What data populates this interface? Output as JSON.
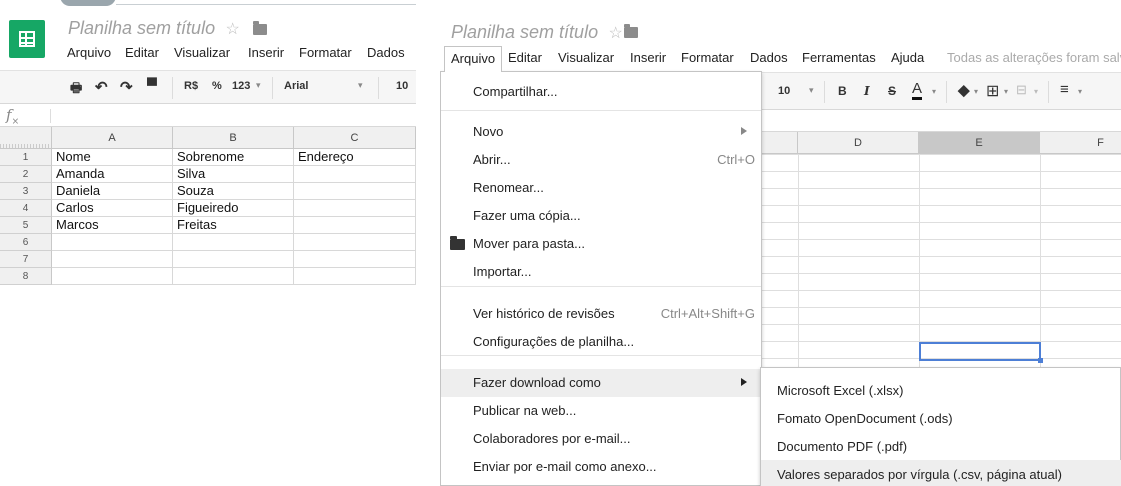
{
  "left": {
    "title": "Planilha sem título",
    "menu": [
      "Arquivo",
      "Editar",
      "Visualizar",
      "Inserir",
      "Formatar",
      "Dados"
    ],
    "toolbar": {
      "currency": "R$",
      "percent": "%",
      "number_format": "123",
      "font": "Arial",
      "font_size": "10"
    },
    "fx_label": "fx",
    "columns": [
      "A",
      "B",
      "C"
    ],
    "rows": [
      "1",
      "2",
      "3",
      "4",
      "5",
      "6",
      "7",
      "8"
    ],
    "cells": [
      [
        "Nome",
        "Sobrenome",
        "Endereço"
      ],
      [
        "Amanda",
        "Silva",
        ""
      ],
      [
        "Daniela",
        "Souza",
        ""
      ],
      [
        "Carlos",
        "Figueiredo",
        ""
      ],
      [
        "Marcos",
        "Freitas",
        ""
      ],
      [
        "",
        "",
        ""
      ],
      [
        "",
        "",
        ""
      ],
      [
        "",
        "",
        ""
      ]
    ]
  },
  "right": {
    "title": "Planilha sem título",
    "menu": [
      "Arquivo",
      "Editar",
      "Visualizar",
      "Inserir",
      "Formatar",
      "Dados",
      "Ferramentas",
      "Ajuda"
    ],
    "saved_status": "Todas as alterações foram salvas no Drive",
    "toolbar": {
      "font_size": "10",
      "bold": "B",
      "italic": "I",
      "strike": "S",
      "text_color": "A"
    },
    "columns": [
      "D",
      "E",
      "F"
    ],
    "file_menu": {
      "items": [
        {
          "label": "Compartilhar...",
          "shortcut": ""
        },
        {
          "label": "Novo",
          "shortcut": "",
          "submenu": true
        },
        {
          "label": "Abrir...",
          "shortcut": "Ctrl+O"
        },
        {
          "label": "Renomear...",
          "shortcut": ""
        },
        {
          "label": "Fazer uma cópia...",
          "shortcut": ""
        },
        {
          "label": "Mover para pasta...",
          "shortcut": "",
          "icon": "folder-icon"
        },
        {
          "label": "Importar...",
          "shortcut": ""
        },
        {
          "label": "Ver histórico de revisões",
          "shortcut": "Ctrl+Alt+Shift+G"
        },
        {
          "label": "Configurações de planilha...",
          "shortcut": ""
        },
        {
          "label": "Fazer download como",
          "shortcut": "",
          "submenu": true
        },
        {
          "label": "Publicar na web...",
          "shortcut": ""
        },
        {
          "label": "Colaboradores por e-mail...",
          "shortcut": ""
        },
        {
          "label": "Enviar por e-mail como anexo...",
          "shortcut": ""
        }
      ]
    },
    "download_submenu": [
      "Microsoft Excel (.xlsx)",
      "Fomato OpenDocument (.ods)",
      "Documento PDF (.pdf)",
      "Valores separados por vírgula (.csv, página atual)"
    ]
  },
  "colors": {
    "sheets_green": "#16a765",
    "selection_blue": "#4d7fd6",
    "menu_highlight": "#eeeeee"
  }
}
